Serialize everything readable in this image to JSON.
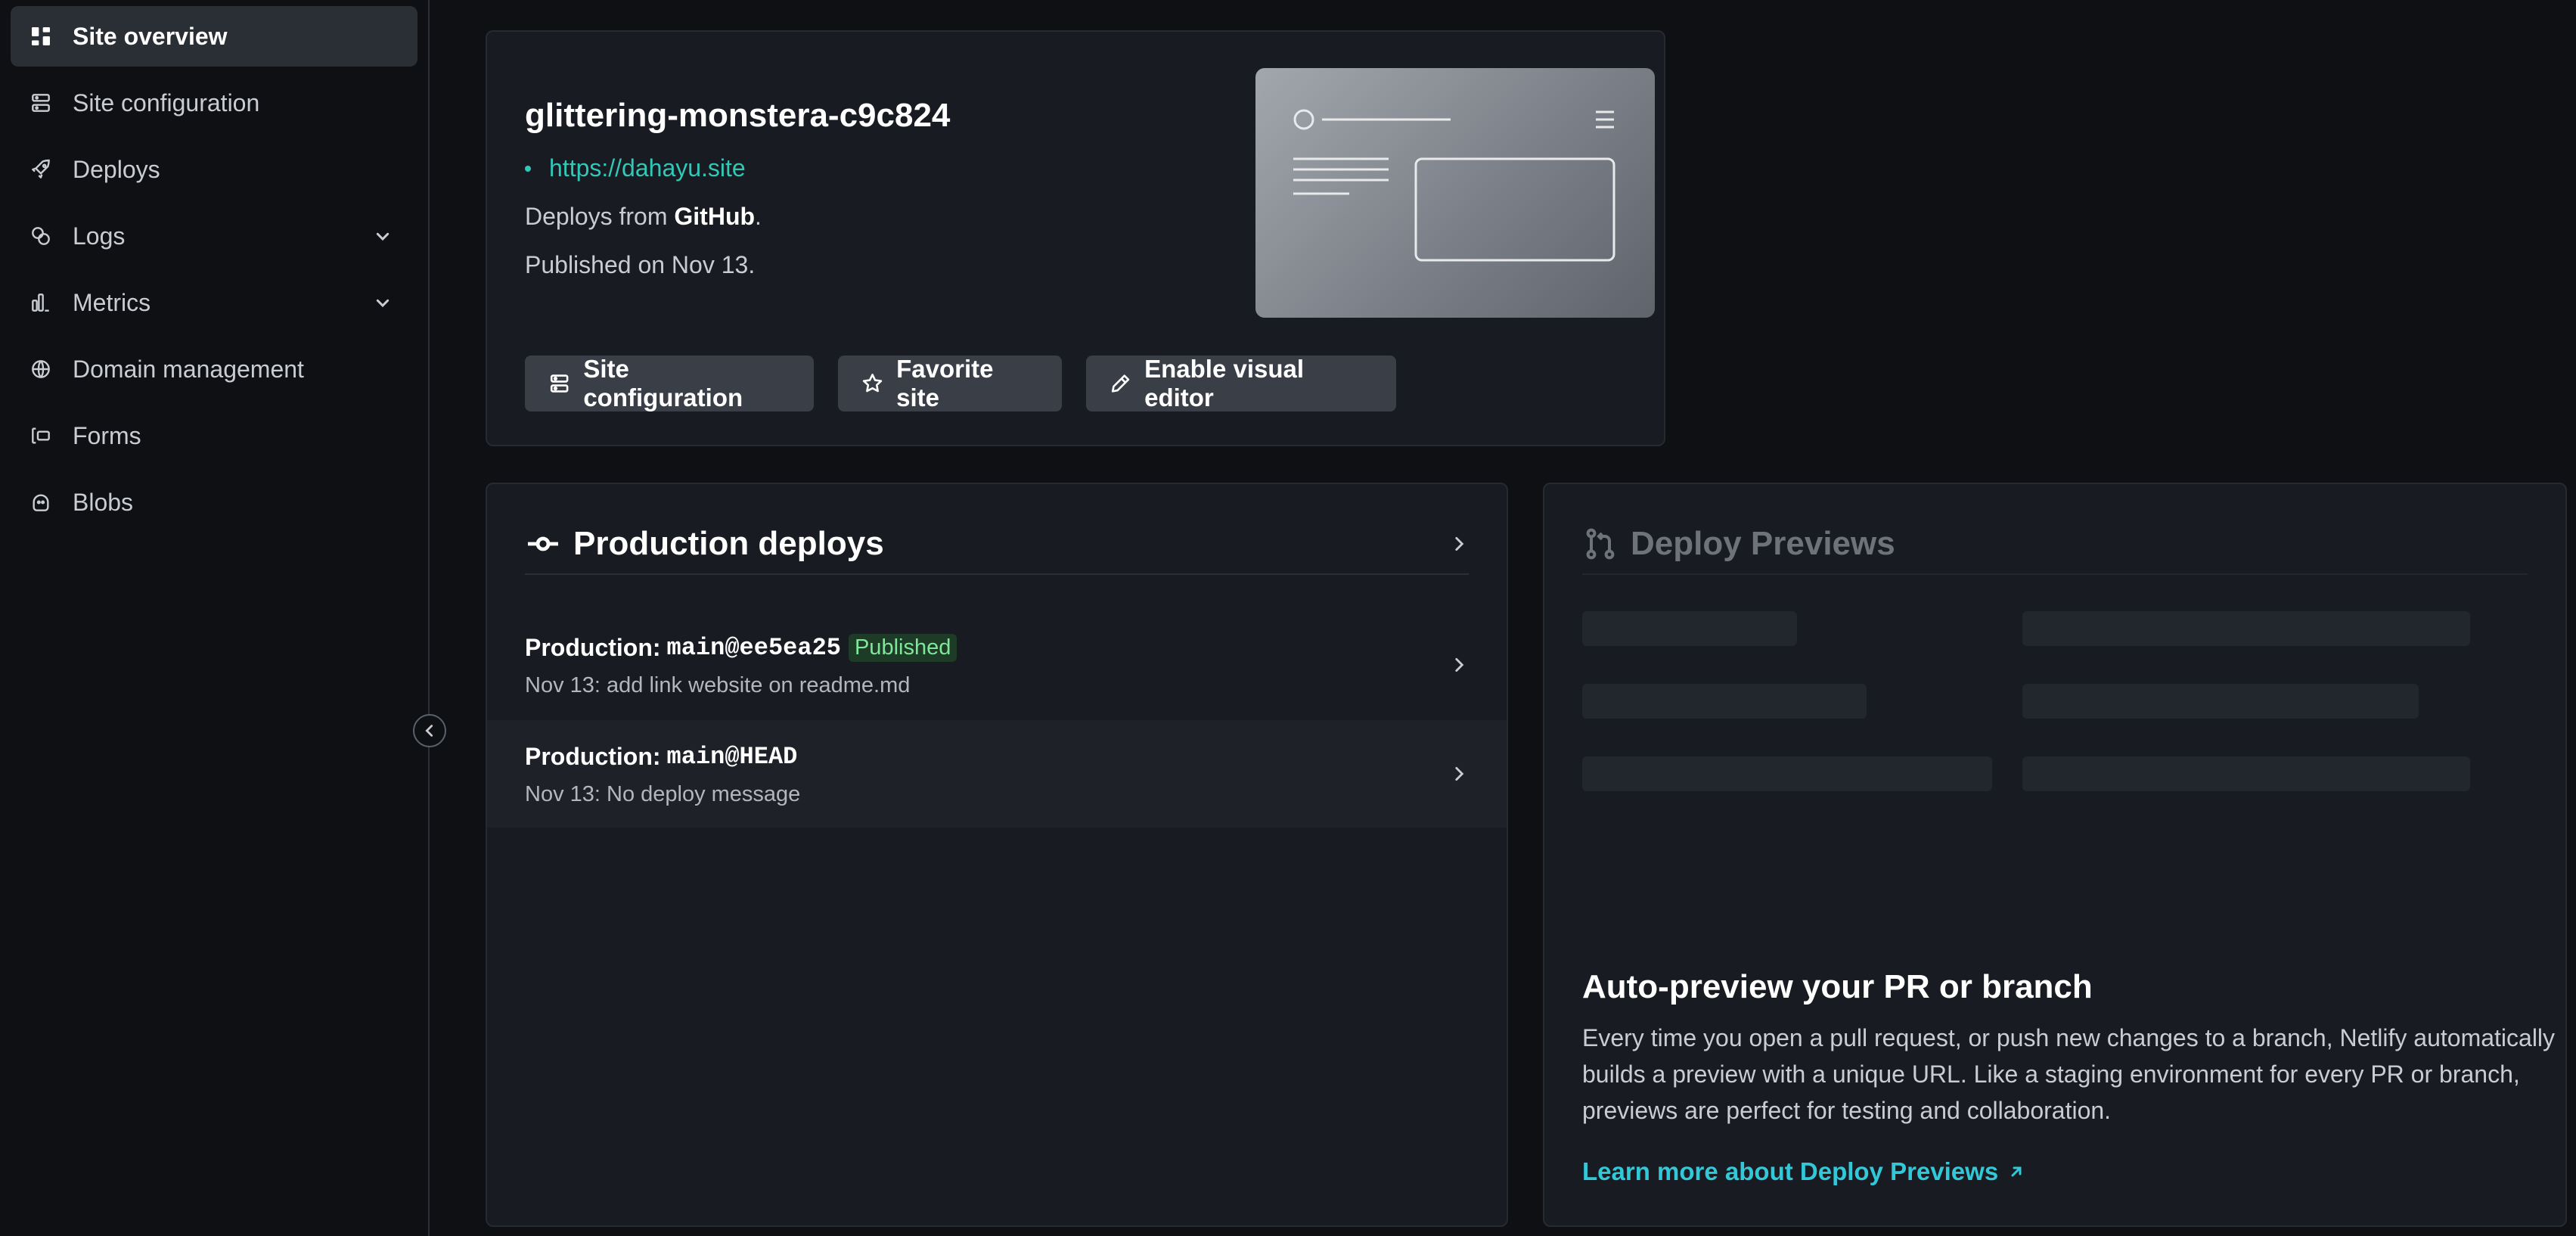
{
  "sidebar": {
    "items": [
      {
        "label": "Site overview",
        "icon": "grid-icon"
      },
      {
        "label": "Site configuration",
        "icon": "server-icon"
      },
      {
        "label": "Deploys",
        "icon": "rocket-icon"
      },
      {
        "label": "Logs",
        "icon": "logs-icon"
      },
      {
        "label": "Metrics",
        "icon": "bar-chart-icon"
      },
      {
        "label": "Domain management",
        "icon": "globe-icon"
      },
      {
        "label": "Forms",
        "icon": "form-icon"
      },
      {
        "label": "Blobs",
        "icon": "blob-icon"
      }
    ]
  },
  "site": {
    "name": "glittering-monstera-c9c824",
    "url": "https://dahayu.site",
    "deploys_from_prefix": "Deploys from ",
    "deploys_from_source": "GitHub",
    "deploys_from_suffix": ".",
    "published": "Published on Nov 13.",
    "buttons": {
      "config": "Site configuration",
      "favorite": "Favorite site",
      "visual_editor": "Enable visual editor"
    }
  },
  "production": {
    "title": "Production deploys",
    "deploys": [
      {
        "label": "Production:",
        "ref": "main@ee5ea25",
        "badge": "Published",
        "message": "Nov 13: add link website on readme.md"
      },
      {
        "label": "Production:",
        "ref": "main@HEAD",
        "badge": "",
        "message": "Nov 13: No deploy message"
      }
    ]
  },
  "previews": {
    "title": "Deploy Previews",
    "heading": "Auto-preview your PR or branch",
    "body": "Every time you open a pull request, or push new changes to a branch, Netlify automatically builds a preview with a unique URL. Like a staging environment for every PR or branch, previews are perfect for testing and collaboration.",
    "link": "Learn more about Deploy Previews"
  },
  "colors": {
    "accent": "#32c8b8",
    "link": "#32c8d8",
    "badge_bg": "#1d3b26",
    "badge_text": "#7ee89a",
    "background": "#0e1014",
    "card": "#181b21"
  }
}
